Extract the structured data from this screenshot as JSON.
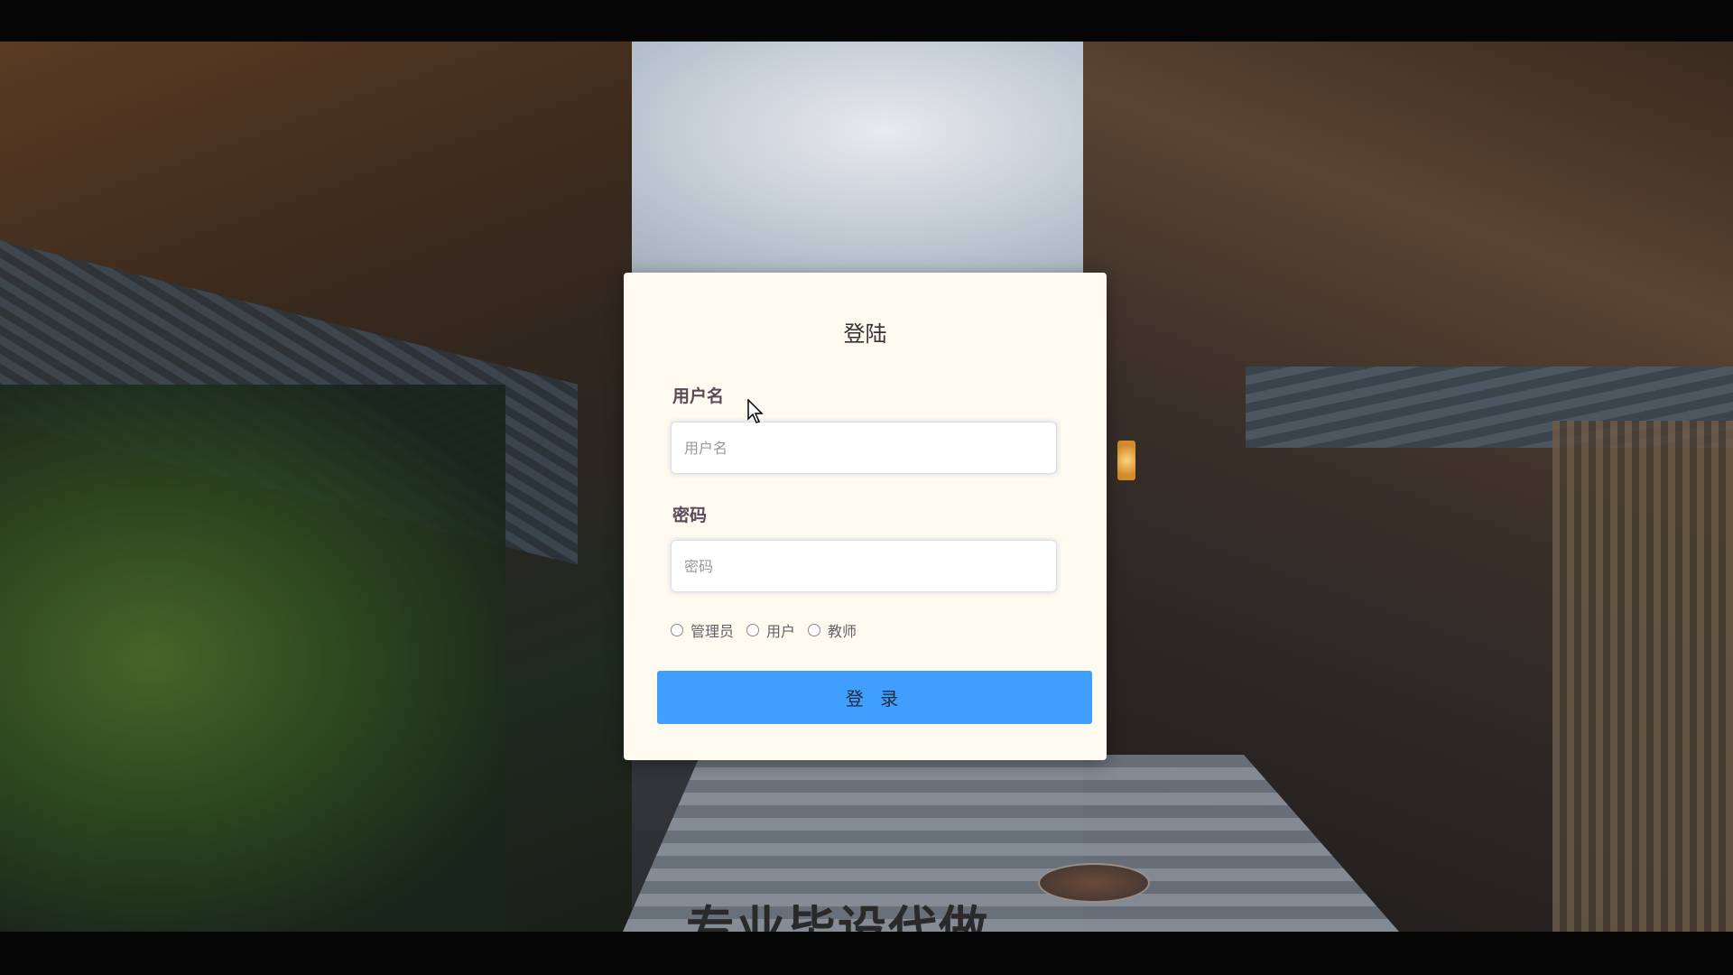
{
  "login": {
    "title": "登陆",
    "username_label": "用户名",
    "username_placeholder": "用户名",
    "username_value": "",
    "password_label": "密码",
    "password_placeholder": "密码",
    "password_value": "",
    "roles": [
      {
        "label": "管理员",
        "selected": false
      },
      {
        "label": "用户",
        "selected": false
      },
      {
        "label": "教师",
        "selected": false
      }
    ],
    "submit_label": "登 录"
  },
  "overlay": {
    "caption": "专业毕设代做"
  },
  "colors": {
    "card_bg": "#fefaf0",
    "button_bg": "#409eff",
    "label_color": "#5a4a5a"
  }
}
